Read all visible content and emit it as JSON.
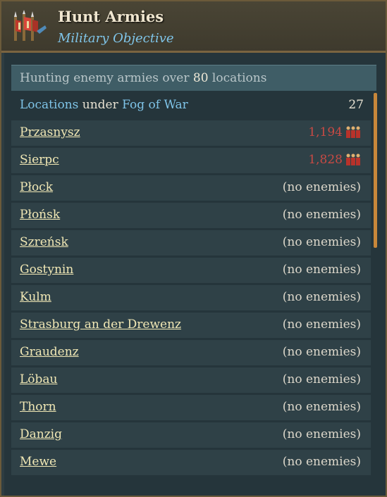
{
  "header": {
    "title": "Hunt Armies",
    "subtitle": "Military Objective",
    "icon": "army-banner-icon"
  },
  "summary": {
    "prefix": "Hunting enemy armies over",
    "count": "80",
    "suffix": "locations"
  },
  "fog": {
    "word_locations": "Locations",
    "word_under": "under",
    "word_fog": "Fog of War",
    "count": "27"
  },
  "locations": [
    {
      "name": "Przasnysz",
      "status": "1,194",
      "has_enemies": true
    },
    {
      "name": "Sierpc",
      "status": "1,828",
      "has_enemies": true
    },
    {
      "name": "Płock",
      "status": "(no enemies)",
      "has_enemies": false
    },
    {
      "name": "Płońsk",
      "status": "(no enemies)",
      "has_enemies": false
    },
    {
      "name": "Szreńsk",
      "status": "(no enemies)",
      "has_enemies": false
    },
    {
      "name": "Gostynin",
      "status": "(no enemies)",
      "has_enemies": false
    },
    {
      "name": "Kulm",
      "status": "(no enemies)",
      "has_enemies": false
    },
    {
      "name": "Strasburg an der Drewenz",
      "status": "(no enemies)",
      "has_enemies": false
    },
    {
      "name": "Graudenz",
      "status": "(no enemies)",
      "has_enemies": false
    },
    {
      "name": "Löbau",
      "status": "(no enemies)",
      "has_enemies": false
    },
    {
      "name": "Thorn",
      "status": "(no enemies)",
      "has_enemies": false
    },
    {
      "name": "Danzig",
      "status": "(no enemies)",
      "has_enemies": false
    },
    {
      "name": "Mewe",
      "status": "(no enemies)",
      "has_enemies": false
    }
  ],
  "colors": {
    "link": "#f1e8b5",
    "enemy": "#c84a44",
    "accent_blue": "#7fc4e8",
    "scrollbar": "#c8873a"
  }
}
